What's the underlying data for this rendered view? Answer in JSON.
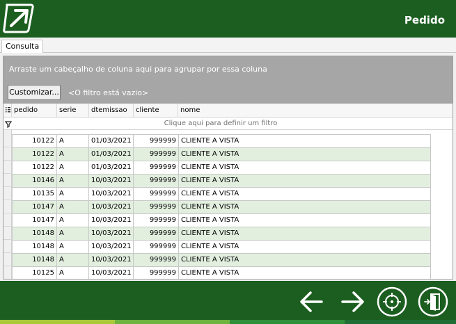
{
  "header": {
    "title": "Pedido",
    "logo_icon": "arrow-box-logo-icon"
  },
  "tabs": [
    {
      "label": "Consulta"
    }
  ],
  "grid": {
    "group_hint": "Arraste um cabeçalho de coluna aqui para agrupar por essa coluna",
    "customize_label": "Customizar...",
    "filter_empty": "<O filtro está vazio>",
    "filter_prompt": "Clique aqui para definir um filtro",
    "columns": [
      "pedido",
      "serie",
      "dtemissao",
      "cliente",
      "nome"
    ],
    "rows": [
      [
        "10122",
        "A",
        "01/03/2021",
        "999999",
        "CLIENTE A VISTA"
      ],
      [
        "10122",
        "A",
        "01/03/2021",
        "999999",
        "CLIENTE A VISTA"
      ],
      [
        "10122",
        "A",
        "01/03/2021",
        "999999",
        "CLIENTE A VISTA"
      ],
      [
        "10146",
        "A",
        "10/03/2021",
        "999999",
        "CLIENTE A VISTA"
      ],
      [
        "10135",
        "A",
        "10/03/2021",
        "999999",
        "CLIENTE A VISTA"
      ],
      [
        "10147",
        "A",
        "10/03/2021",
        "999999",
        "CLIENTE A VISTA"
      ],
      [
        "10147",
        "A",
        "10/03/2021",
        "999999",
        "CLIENTE A VISTA"
      ],
      [
        "10148",
        "A",
        "10/03/2021",
        "999999",
        "CLIENTE A VISTA"
      ],
      [
        "10148",
        "A",
        "10/03/2021",
        "999999",
        "CLIENTE A VISTA"
      ],
      [
        "10148",
        "A",
        "10/03/2021",
        "999999",
        "CLIENTE A VISTA"
      ],
      [
        "10125",
        "A",
        "10/03/2021",
        "999999",
        "CLIENTE A VISTA"
      ]
    ]
  },
  "footer": {
    "buttons": [
      {
        "name": "previous-button",
        "icon": "arrow-left-icon"
      },
      {
        "name": "next-button",
        "icon": "arrow-right-icon"
      },
      {
        "name": "locate-button",
        "icon": "crosshair-icon"
      },
      {
        "name": "exit-button",
        "icon": "exit-door-icon"
      }
    ]
  },
  "colors": {
    "brand_green": "#1c5e20",
    "alt_row": "#e2efdf",
    "group_panel": "#a6a6a6"
  }
}
